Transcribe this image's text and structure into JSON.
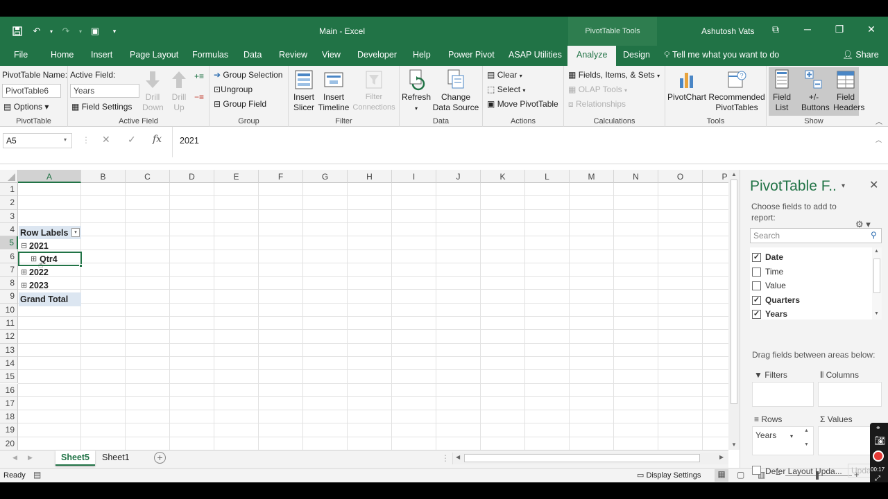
{
  "titlebar": {
    "doc_title": "Main  -  Excel",
    "context_tab": "PivotTable Tools",
    "user": "Ashutosh Vats"
  },
  "tabs": [
    "File",
    "Home",
    "Insert",
    "Page Layout",
    "Formulas",
    "Data",
    "Review",
    "View",
    "Developer",
    "Help",
    "Power Pivot",
    "ASAP Utilities",
    "Analyze",
    "Design"
  ],
  "active_tab": "Analyze",
  "tell_me": "Tell me what you want to do",
  "share": "Share",
  "ribbon": {
    "pivottable": {
      "name_label": "PivotTable Name:",
      "name_value": "PivotTable6",
      "options": "Options",
      "group": "PivotTable"
    },
    "active_field": {
      "label": "Active Field:",
      "value": "Years",
      "field_settings": "Field Settings",
      "drill_down": "Drill Down",
      "drill_up": "Drill Up",
      "group": "Active Field"
    },
    "group": {
      "group_selection": "Group Selection",
      "ungroup": "Ungroup",
      "group_field": "Group Field",
      "group": "Group"
    },
    "filter": {
      "insert_slicer": "Insert Slicer",
      "insert_timeline": "Insert Timeline",
      "filter_connections": "Filter Connections",
      "group": "Filter"
    },
    "data": {
      "refresh": "Refresh",
      "change_data_source": "Change Data Source",
      "group": "Data"
    },
    "actions": {
      "clear": "Clear",
      "select": "Select",
      "move_pivottable": "Move PivotTable",
      "group": "Actions"
    },
    "calculations": {
      "fields_items_sets": "Fields, Items, & Sets",
      "olap_tools": "OLAP Tools",
      "relationships": "Relationships",
      "group": "Calculations"
    },
    "tools": {
      "pivotchart": "PivotChart",
      "recommended": "Recommended PivotTables",
      "group": "Tools"
    },
    "show": {
      "field_list": "Field List",
      "buttons": "+/- Buttons",
      "field_headers": "Field Headers",
      "group": "Show"
    }
  },
  "formula_bar": {
    "name_box": "A5",
    "value": "2021"
  },
  "columns": [
    "A",
    "B",
    "C",
    "D",
    "E",
    "F",
    "G",
    "H",
    "I",
    "J",
    "K",
    "L",
    "M",
    "N",
    "O",
    "P"
  ],
  "rows": [
    "1",
    "2",
    "3",
    "4",
    "5",
    "6",
    "7",
    "8",
    "9",
    "10",
    "11",
    "12",
    "13",
    "14",
    "15",
    "16",
    "17",
    "18",
    "19",
    "20"
  ],
  "pivot": {
    "row_labels": "Row Labels",
    "items": [
      {
        "label": "2021",
        "toggle": "⊟"
      },
      {
        "label": "Qtr4",
        "toggle": "⊞"
      },
      {
        "label": "2022",
        "toggle": "⊞"
      },
      {
        "label": "2023",
        "toggle": "⊞"
      }
    ],
    "grand_total": "Grand Total"
  },
  "sheets": [
    "Sheet5",
    "Sheet1"
  ],
  "active_sheet": "Sheet5",
  "status": {
    "ready": "Ready",
    "display_settings": "Display Settings"
  },
  "pane": {
    "title": "PivotTable F..",
    "hint": "Choose fields to add to report:",
    "search_placeholder": "Search",
    "fields": [
      {
        "name": "Date",
        "checked": true
      },
      {
        "name": "Time",
        "checked": false
      },
      {
        "name": "Value",
        "checked": false
      },
      {
        "name": "Quarters",
        "checked": true
      },
      {
        "name": "Years",
        "checked": true
      }
    ],
    "drag_hint": "Drag fields between areas below:",
    "filters": "Filters",
    "columns": "Columns",
    "rows": "Rows",
    "values": "Values",
    "rows_field": "Years",
    "defer": "Defer Layout Upda...",
    "update": "Upda"
  },
  "recorder_time": "00:17",
  "colors": {
    "accent": "#217346",
    "pivot_header": "#dce6f1"
  }
}
